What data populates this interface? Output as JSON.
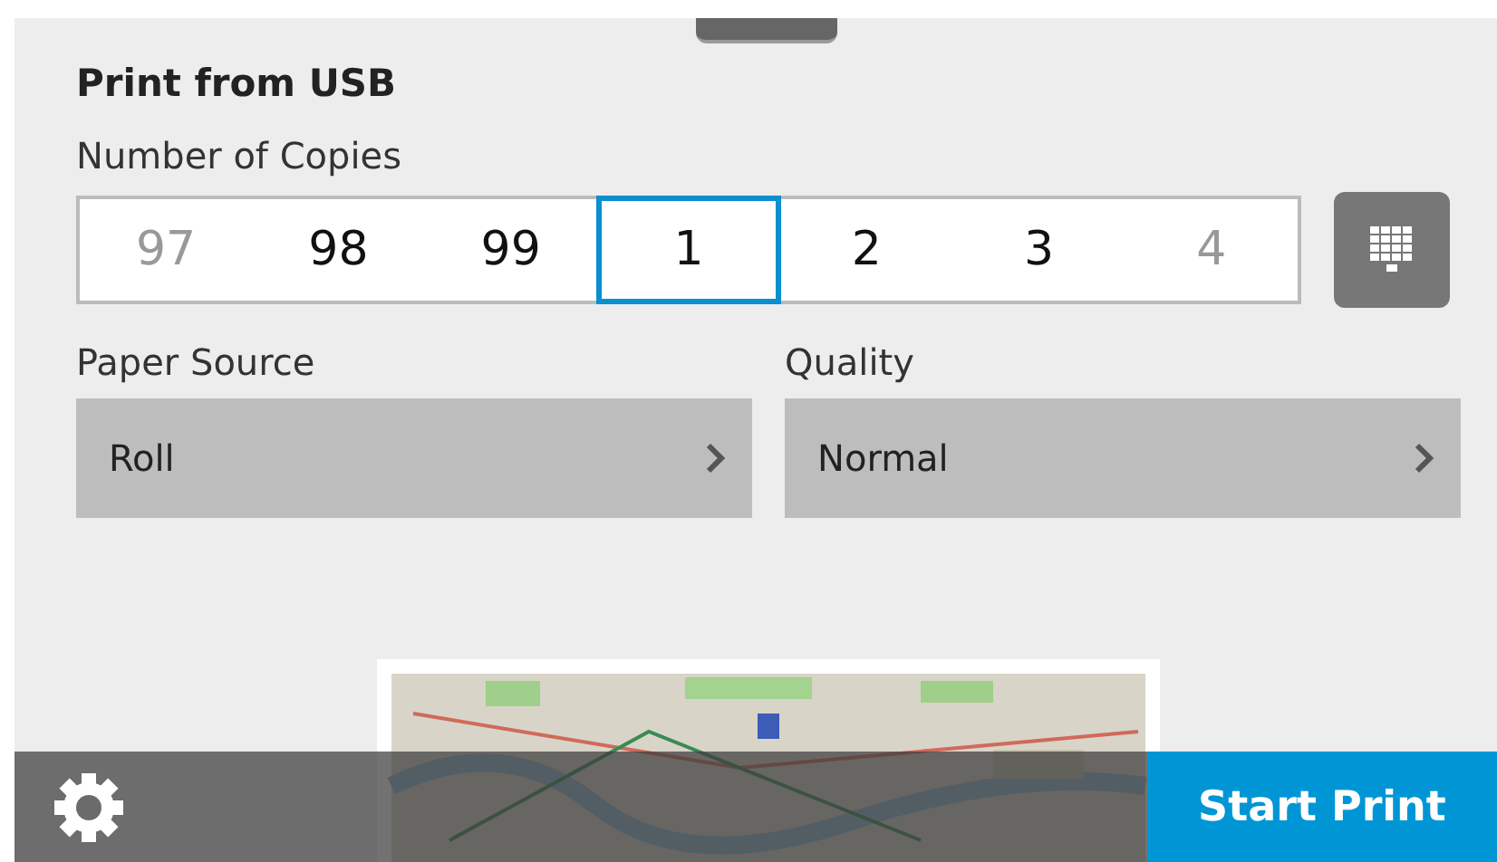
{
  "title": "Print from USB",
  "copies": {
    "label": "Number of Copies",
    "items": [
      {
        "value": "97",
        "selected": false,
        "dimmed": true
      },
      {
        "value": "98",
        "selected": false,
        "dimmed": false
      },
      {
        "value": "99",
        "selected": false,
        "dimmed": false
      },
      {
        "value": "1",
        "selected": true,
        "dimmed": false
      },
      {
        "value": "2",
        "selected": false,
        "dimmed": false
      },
      {
        "value": "3",
        "selected": false,
        "dimmed": false
      },
      {
        "value": "4",
        "selected": false,
        "dimmed": true
      }
    ]
  },
  "settings": [
    {
      "label": "Paper Source",
      "value": "Roll"
    },
    {
      "label": "Quality",
      "value": "Normal"
    }
  ],
  "start_button": "Start Print"
}
